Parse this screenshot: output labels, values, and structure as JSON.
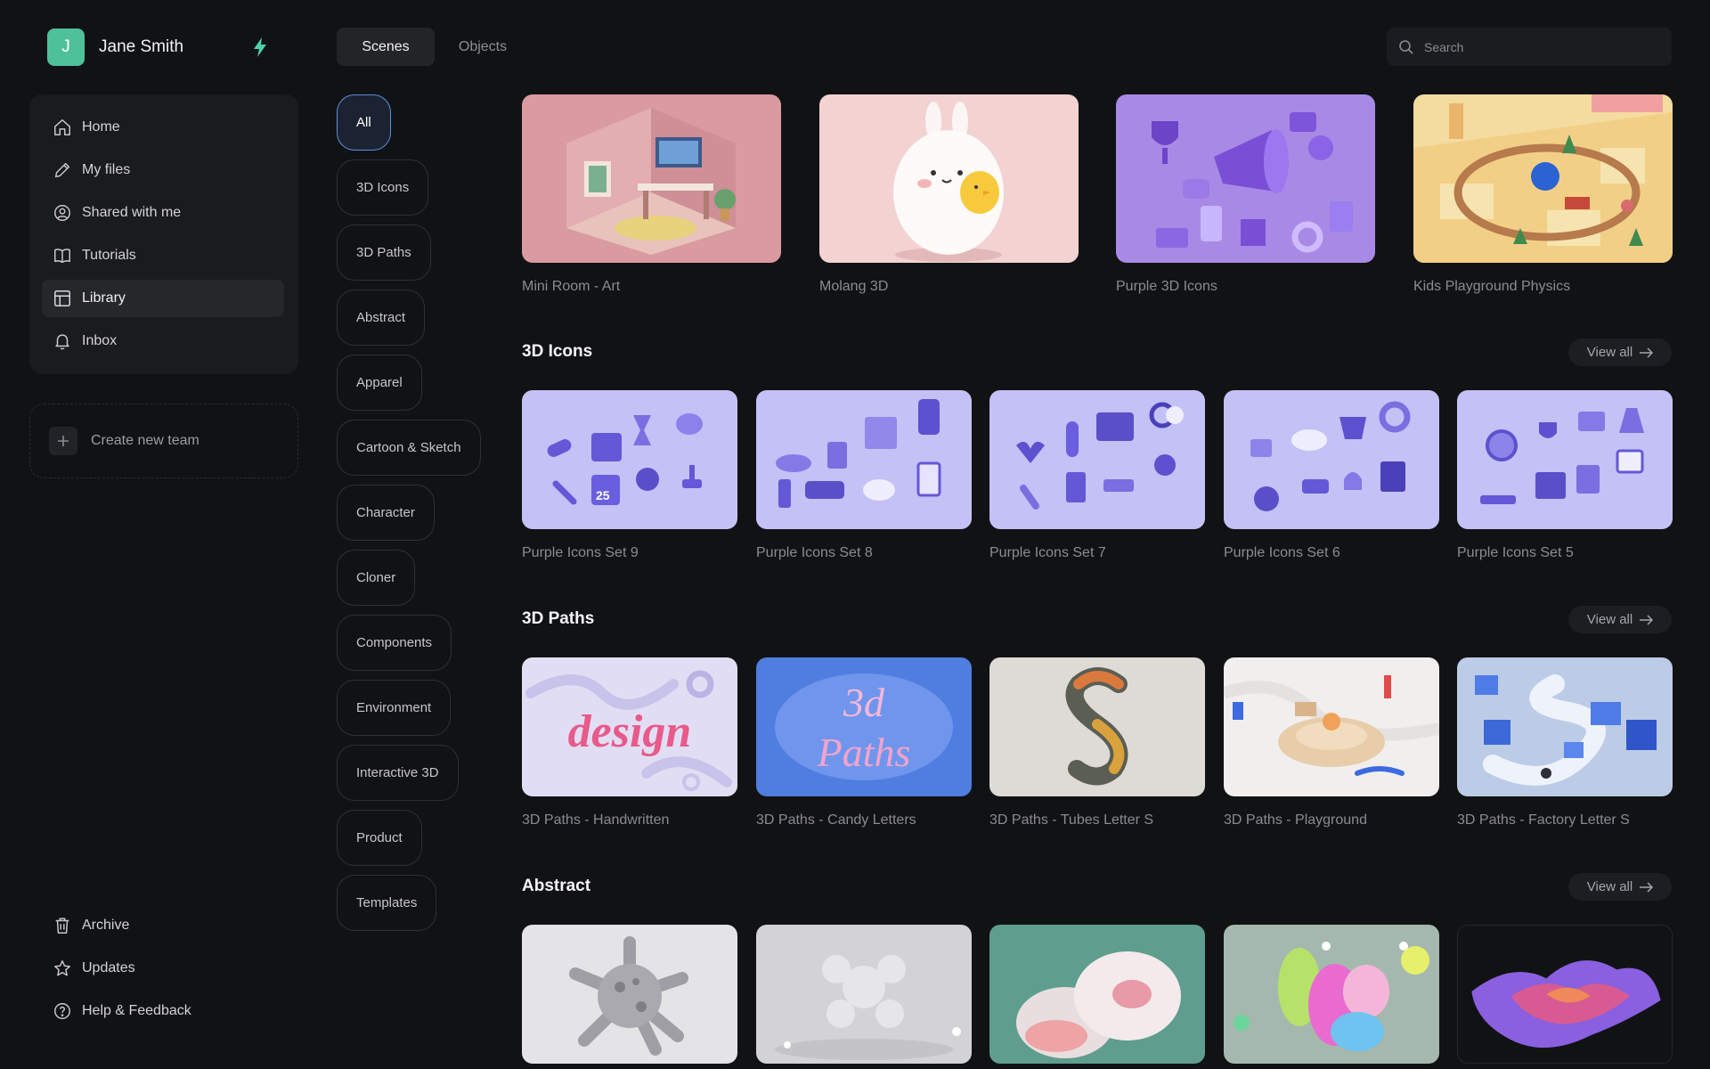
{
  "user": {
    "initial": "J",
    "name": "Jane Smith"
  },
  "nav": [
    {
      "label": "Home",
      "icon": "home-icon"
    },
    {
      "label": "My files",
      "icon": "pencil-icon"
    },
    {
      "label": "Shared with me",
      "icon": "user-circle-icon"
    },
    {
      "label": "Tutorials",
      "icon": "book-icon"
    },
    {
      "label": "Library",
      "icon": "library-icon",
      "active": true
    },
    {
      "label": "Inbox",
      "icon": "bell-icon"
    }
  ],
  "create_team": "Create new team",
  "bottom_nav": [
    {
      "label": "Archive",
      "icon": "trash-icon"
    },
    {
      "label": "Updates",
      "icon": "star-icon"
    },
    {
      "label": "Help & Feedback",
      "icon": "help-icon"
    }
  ],
  "tabs": {
    "active": "Scenes",
    "inactive": "Objects"
  },
  "search": {
    "placeholder": "Search"
  },
  "filters": [
    "All",
    "3D Icons",
    "3D Paths",
    "Abstract",
    "Apparel",
    "Cartoon & Sketch",
    "Character",
    "Cloner",
    "Components",
    "Environment",
    "Interactive 3D",
    "Product",
    "Templates"
  ],
  "featured": [
    "Mini Room - Art",
    "Molang 3D",
    "Purple 3D Icons",
    "Kids Playground Physics"
  ],
  "view_all": "View all",
  "sections": [
    {
      "title": "3D Icons",
      "items": [
        "Purple Icons Set 9",
        "Purple Icons Set 8",
        "Purple Icons Set 7",
        "Purple Icons Set 6",
        "Purple Icons Set 5"
      ]
    },
    {
      "title": "3D Paths",
      "items": [
        "3D Paths - Handwritten",
        "3D Paths - Candy Letters",
        "3D Paths - Tubes Letter S",
        "3D Paths - Playground",
        "3D Paths - Factory Letter S"
      ]
    },
    {
      "title": "Abstract",
      "items": []
    }
  ],
  "thumb_text": {
    "calendar": "25",
    "design": "design",
    "candy_line1": "3d",
    "candy_line2": "Paths"
  },
  "colors": {
    "accent": "#5b8fe0",
    "avatar": "#4fc19a",
    "bolt": "#4fd1a8",
    "background": "#111214"
  }
}
